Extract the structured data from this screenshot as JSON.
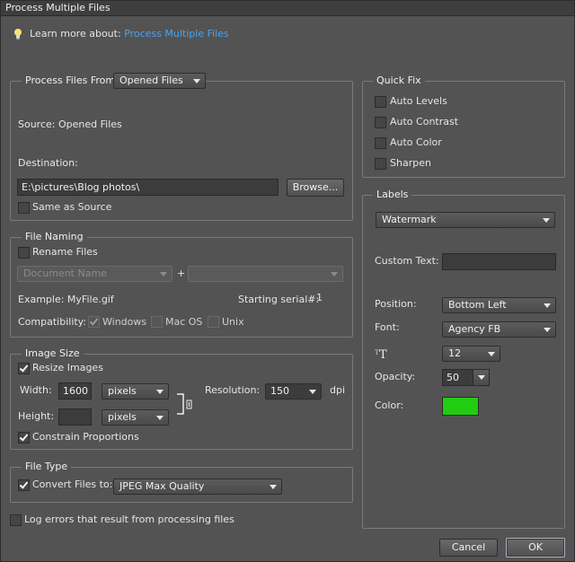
{
  "window": {
    "title": "Process Multiple Files"
  },
  "learn_more": {
    "prefix": "Learn more about:",
    "link": "Process Multiple Files"
  },
  "process_files": {
    "legend_label": "Process Files From:",
    "source_select": "Opened Files",
    "source_text": "Source: Opened Files",
    "destination_label": "Destination:",
    "destination_value": "E:\\pictures\\Blog photos\\",
    "browse_label": "Browse...",
    "same_as_source_label": "Same as Source",
    "same_as_source_checked": false
  },
  "file_naming": {
    "legend": "File Naming",
    "rename_label": "Rename Files",
    "rename_checked": false,
    "name_select": "Document Name",
    "plus": "+",
    "second_select": "",
    "example": "Example: MyFile.gif",
    "starting_serial_label": "Starting serial#:",
    "starting_serial_value": "1",
    "compatibility_label": "Compatibility:",
    "windows_label": "Windows",
    "windows_checked": true,
    "macos_label": "Mac OS",
    "macos_checked": false,
    "unix_label": "Unix",
    "unix_checked": false
  },
  "image_size": {
    "legend": "Image Size",
    "resize_label": "Resize Images",
    "resize_checked": true,
    "width_label": "Width:",
    "width_value": "1600",
    "width_unit": "pixels",
    "height_label": "Height:",
    "height_value": "",
    "height_unit": "pixels",
    "resolution_label": "Resolution:",
    "resolution_value": "150",
    "resolution_unit": "dpi",
    "constrain_label": "Constrain Proportions",
    "constrain_checked": true
  },
  "file_type": {
    "legend": "File Type",
    "convert_label": "Convert Files to:",
    "convert_checked": true,
    "format_select": "JPEG Max Quality"
  },
  "log_errors": {
    "label": "Log errors that result from processing files",
    "checked": false
  },
  "quick_fix": {
    "legend": "Quick Fix",
    "items": [
      {
        "label": "Auto Levels",
        "checked": false
      },
      {
        "label": "Auto Contrast",
        "checked": false
      },
      {
        "label": "Auto Color",
        "checked": false
      },
      {
        "label": "Sharpen",
        "checked": false
      }
    ]
  },
  "labels": {
    "legend": "Labels",
    "type_select": "Watermark",
    "custom_text_label": "Custom Text:",
    "custom_text_value": "",
    "position_label": "Position:",
    "position_value": "Bottom Left",
    "font_label": "Font:",
    "font_value": "Agency FB",
    "font_size_value": "12",
    "opacity_label": "Opacity:",
    "opacity_value": "50",
    "color_label": "Color:",
    "color_swatch": "#22cc11"
  },
  "buttons": {
    "cancel": "Cancel",
    "ok": "OK"
  }
}
